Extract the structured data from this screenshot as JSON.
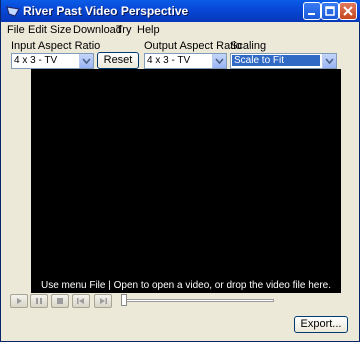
{
  "window": {
    "title": "River Past Video Perspective"
  },
  "menu": [
    "File",
    "Edit",
    "Size",
    "Download",
    "Try",
    "Help"
  ],
  "input_aspect": {
    "label": "Input Aspect Ratio",
    "value": "4 x 3 - TV"
  },
  "reset_label": "Reset",
  "output_aspect": {
    "label": "Output Aspect Ratio",
    "value": "4 x 3 - TV"
  },
  "scaling": {
    "label": "Scaling",
    "value": "Scale to Fit"
  },
  "video": {
    "message": "Use menu File | Open to open a video, or drop the video file here."
  },
  "seek": {
    "position": 0
  },
  "export_label": "Export...",
  "colors": {
    "titlebar": "#0a52e0",
    "chrome": "#ece9d8",
    "video_bg": "#000000",
    "selection": "#316ac5"
  }
}
